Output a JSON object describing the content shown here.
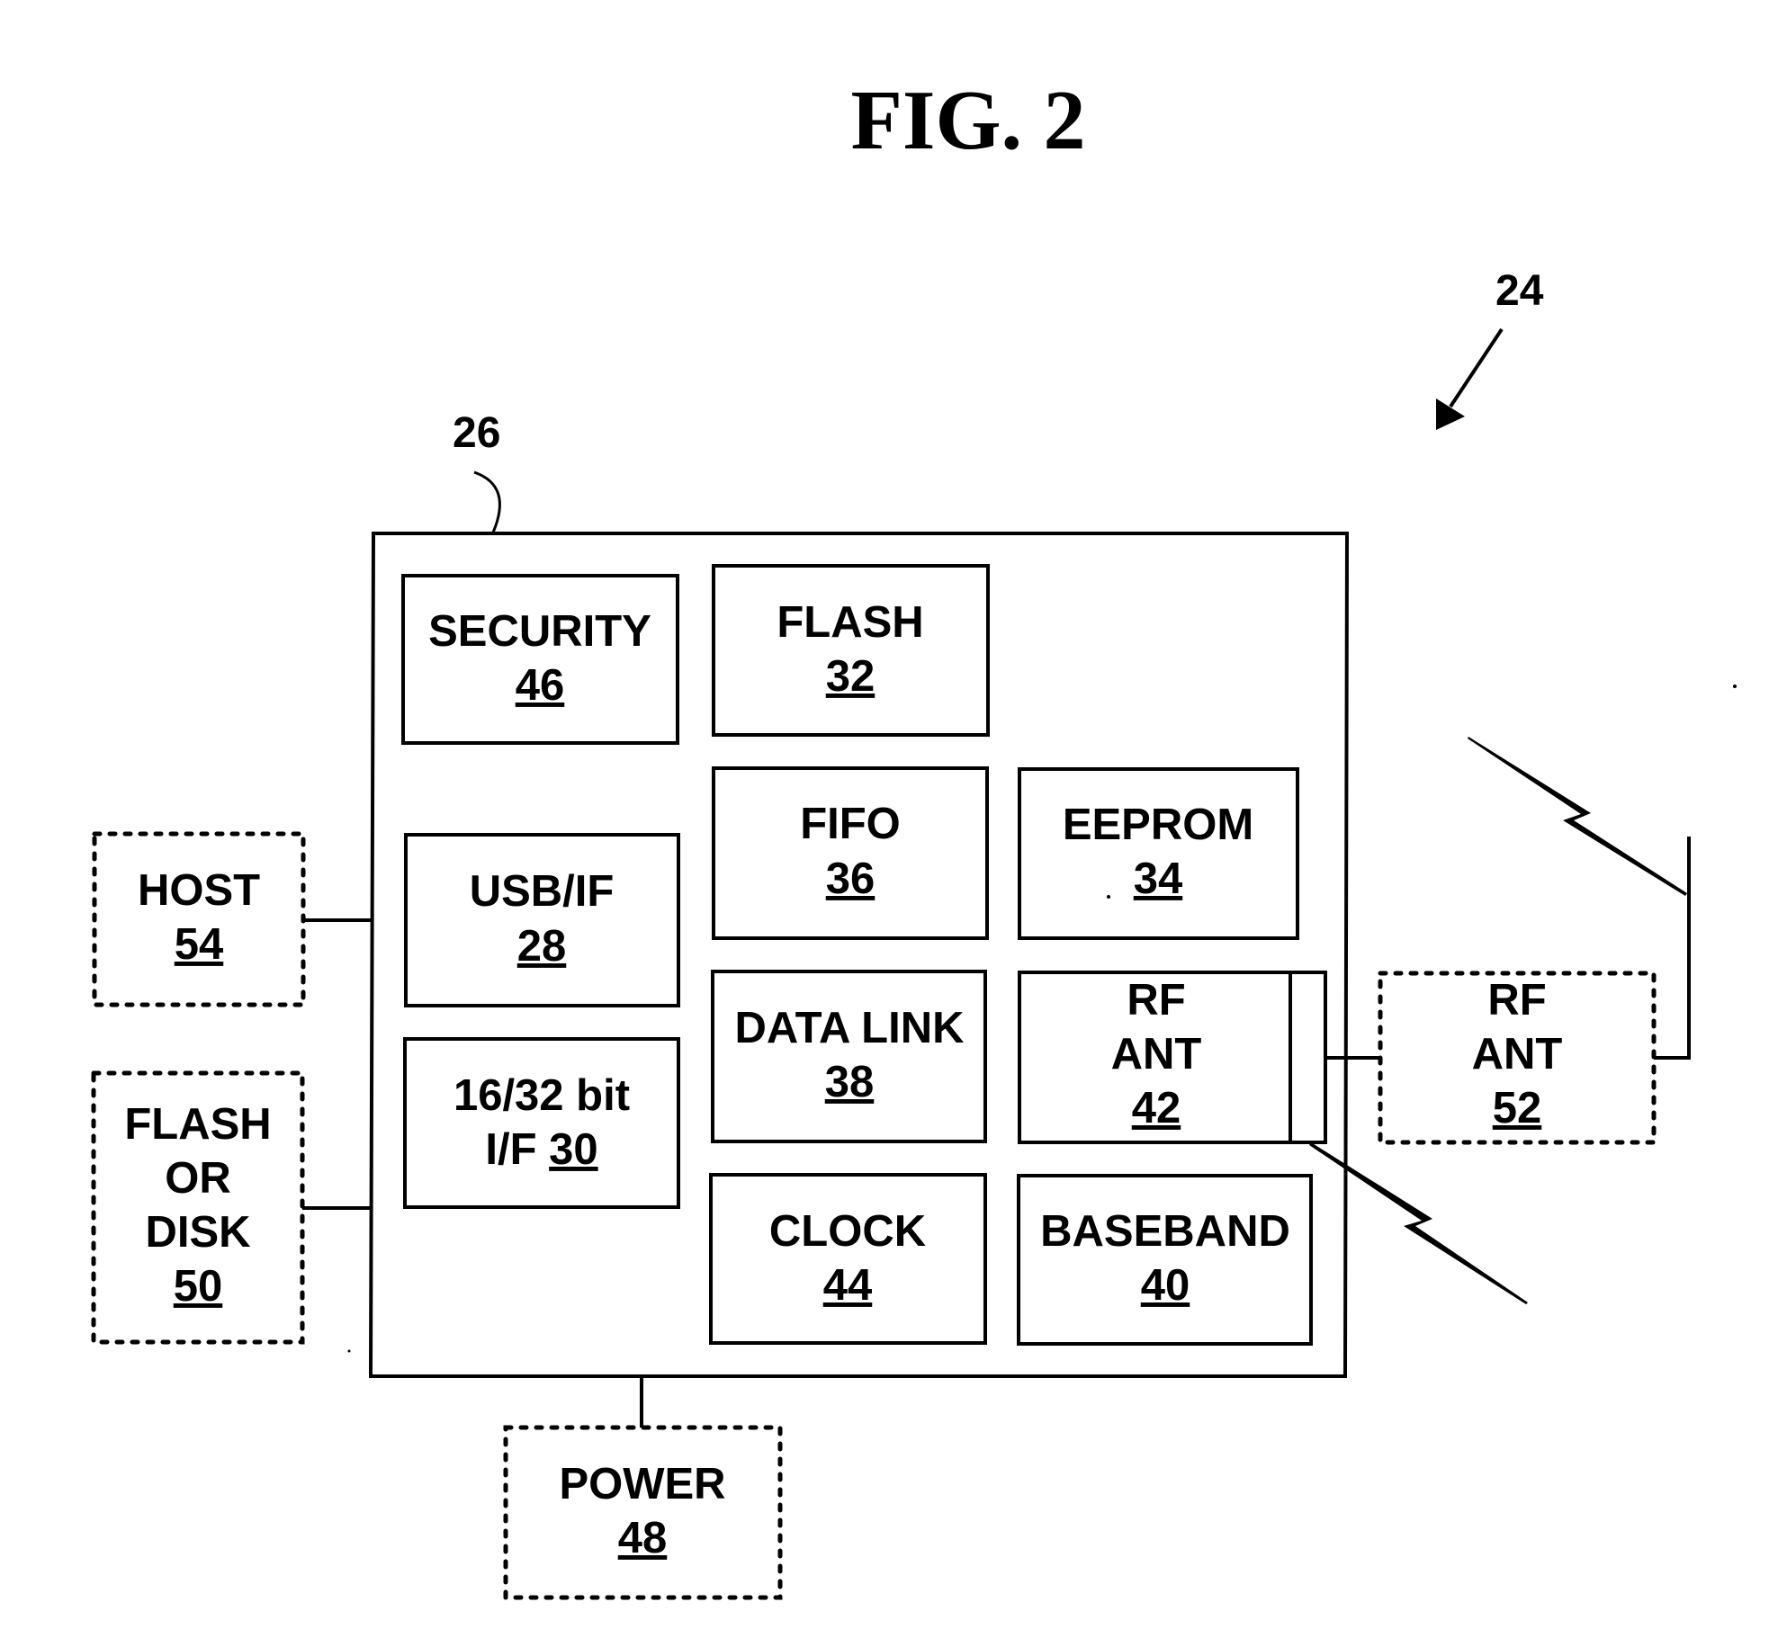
{
  "title": "FIG. 2",
  "reference_labels": {
    "device": "24",
    "chip": "26"
  },
  "blocks": {
    "security": {
      "label": "SECURITY",
      "number": "46"
    },
    "flash": {
      "label": "FLASH",
      "number": "32"
    },
    "usb_if": {
      "label": "USB/IF",
      "number": "28"
    },
    "fifo": {
      "label": "FIFO",
      "number": "36"
    },
    "eeprom": {
      "label": "EEPROM",
      "number": "34"
    },
    "bit_if": {
      "line1": "16/32 bit",
      "line2_prefix": "I/F",
      "number": "30"
    },
    "data_link": {
      "label": "DATA LINK",
      "number": "38"
    },
    "rf_ant_internal": {
      "line1": "RF",
      "line2": "ANT",
      "number": "42"
    },
    "clock": {
      "label": "CLOCK",
      "number": "44"
    },
    "baseband": {
      "label": "BASEBAND",
      "number": "40"
    }
  },
  "external": {
    "host": {
      "label": "HOST",
      "number": "54"
    },
    "flash_or_disk": {
      "line1": "FLASH",
      "line2": "OR",
      "line3": "DISK",
      "number": "50"
    },
    "power": {
      "label": "POWER",
      "number": "48"
    },
    "rf_ant_external": {
      "line1": "RF",
      "line2": "ANT",
      "number": "52"
    }
  }
}
